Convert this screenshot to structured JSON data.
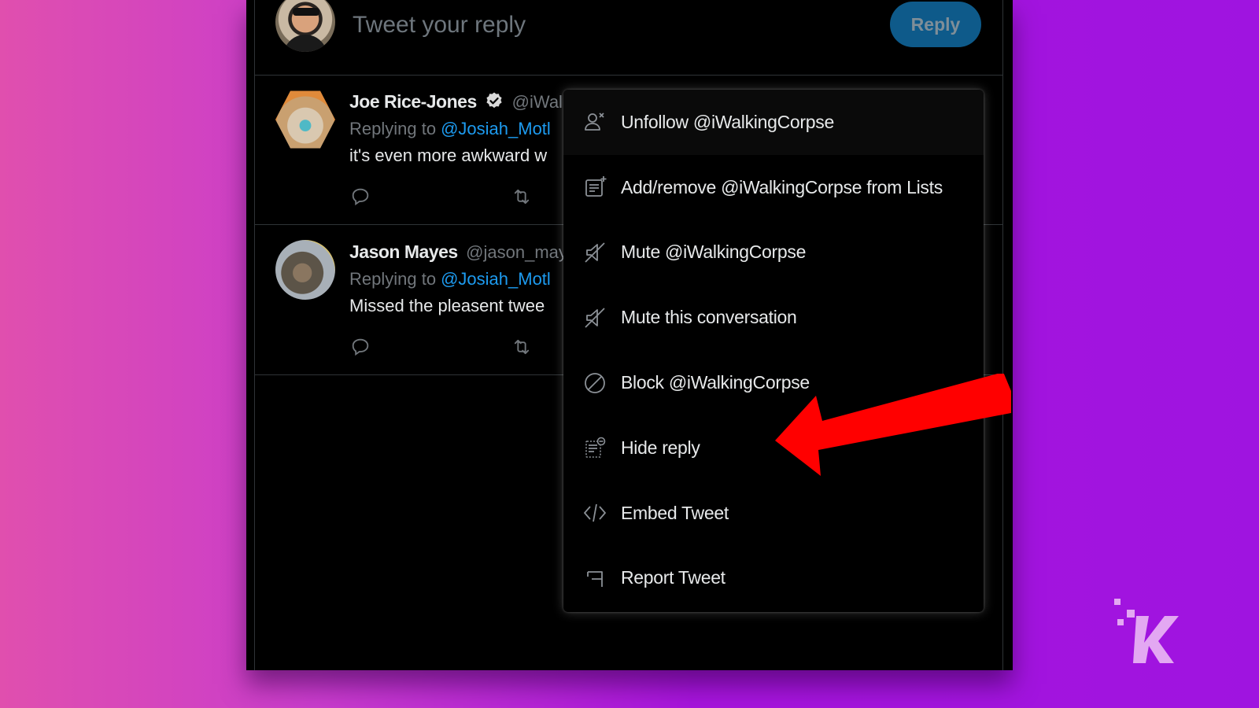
{
  "composer": {
    "placeholder": "Tweet your reply",
    "reply_label": "Reply"
  },
  "tweets": [
    {
      "name": "Joe Rice-Jones",
      "verified": true,
      "handle": "@iWal",
      "replying_prefix": "Replying to",
      "replying_to": "@Josiah_Motl",
      "text": "it's even more awkward w"
    },
    {
      "name": "Jason Mayes",
      "verified": false,
      "handle": "@jason_may",
      "replying_prefix": "Replying to",
      "replying_to": "@Josiah_Motl",
      "text": "Missed the pleasent twee"
    }
  ],
  "menu": {
    "items": [
      {
        "icon": "unfollow-user-icon",
        "label": "Unfollow @iWalkingCorpse",
        "highlighted": true
      },
      {
        "icon": "add-to-list-icon",
        "label": "Add/remove @iWalkingCorpse from Lists",
        "highlighted": false
      },
      {
        "icon": "mute-icon",
        "label": "Mute @iWalkingCorpse",
        "highlighted": false
      },
      {
        "icon": "mute-conversation-icon",
        "label": "Mute this conversation",
        "highlighted": false
      },
      {
        "icon": "block-icon",
        "label": "Block @iWalkingCorpse",
        "highlighted": false
      },
      {
        "icon": "hide-reply-icon",
        "label": "Hide reply",
        "highlighted": false
      },
      {
        "icon": "embed-code-icon",
        "label": "Embed Tweet",
        "highlighted": false
      },
      {
        "icon": "report-flag-icon",
        "label": "Report Tweet",
        "highlighted": false
      }
    ]
  },
  "annotation": {
    "arrow_color": "#ff0000",
    "points_to": "Hide reply"
  },
  "colors": {
    "accent": "#1d9bf0",
    "reply_button": "#0e5a8a",
    "background_left": "#e04fae",
    "background_right": "#9f14e0"
  }
}
